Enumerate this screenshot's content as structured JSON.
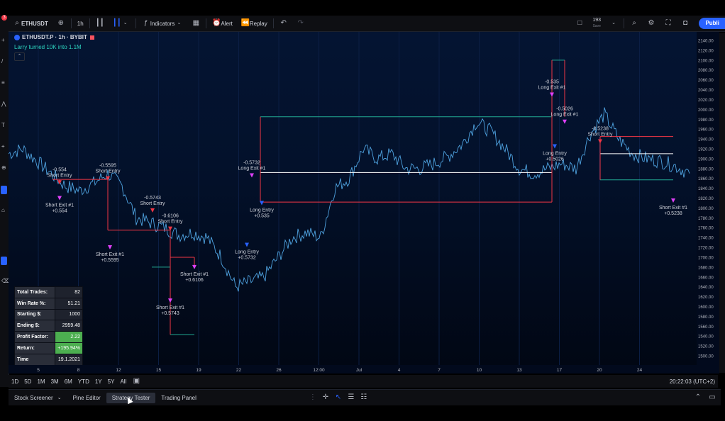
{
  "toolbar": {
    "symbol": "ETHUSDT",
    "interval": "1h",
    "indicators_label": "Indicators",
    "alert_label": "Alert",
    "replay_label": "Replay",
    "counter": "193",
    "counter_sub": "Save",
    "publish_label": "Publi",
    "notification_badge": "3"
  },
  "legend": {
    "title": "ETHUSDT.P · 1h · BYBIT",
    "strategy_name": "Larry turned 10K into 1.1M"
  },
  "stats": [
    {
      "label": "Total Trades:",
      "value": "82",
      "highlight": false
    },
    {
      "label": "Win Rate %:",
      "value": "51.21",
      "highlight": false
    },
    {
      "label": "Starting $:",
      "value": "1000",
      "highlight": false
    },
    {
      "label": "Ending $:",
      "value": "2959.48",
      "highlight": false
    },
    {
      "label": "Profit Factor:",
      "value": "2.22",
      "highlight": true
    },
    {
      "label": "Return:",
      "value": "+195.94%",
      "highlight": true
    },
    {
      "label": "Time",
      "value": "19.1.2021",
      "highlight": false
    }
  ],
  "chart_data": {
    "type": "line",
    "price_ticks": [
      "2140.00",
      "2120.00",
      "2100.00",
      "2080.00",
      "2060.00",
      "2040.00",
      "2020.00",
      "2000.00",
      "1980.00",
      "1960.00",
      "1940.00",
      "1920.00",
      "1900.00",
      "1880.00",
      "1860.00",
      "1840.00",
      "1820.00",
      "1800.00",
      "1780.00",
      "1760.00",
      "1740.00",
      "1720.00",
      "1700.00",
      "1680.00",
      "1660.00",
      "1640.00",
      "1620.00",
      "1600.00",
      "1580.00",
      "1560.00",
      "1540.00",
      "1520.00",
      "1500.00"
    ],
    "time_ticks": [
      "5",
      "8",
      "12",
      "15",
      "19",
      "22",
      "26",
      "12:00",
      "Jul",
      "4",
      "7",
      "10",
      "13",
      "17",
      "20",
      "24"
    ],
    "ylim": [
      1492,
      2150
    ],
    "price_line": {
      "x": [
        0,
        20,
        40,
        60,
        80,
        100,
        120,
        140,
        160,
        180,
        200,
        220,
        240,
        260,
        280,
        300,
        320,
        340,
        360,
        380,
        400,
        420,
        440,
        460,
        480,
        500,
        520,
        540,
        560,
        580,
        600,
        620,
        640,
        660,
        680,
        700,
        720,
        740,
        760,
        780,
        800,
        820,
        840,
        860,
        880,
        900,
        920,
        940,
        960
      ],
      "y": [
        1910,
        1920,
        1895,
        1870,
        1845,
        1835,
        1850,
        1870,
        1845,
        1780,
        1770,
        1760,
        1745,
        1750,
        1740,
        1700,
        1640,
        1650,
        1660,
        1700,
        1740,
        1750,
        1740,
        1840,
        1860,
        1920,
        1900,
        1910,
        1880,
        1880,
        1890,
        1905,
        1930,
        1975,
        1955,
        1920,
        1880,
        1870,
        1880,
        1890,
        1880,
        1950,
        1990,
        1940,
        1910,
        1900,
        1895,
        1885,
        1870
      ]
    },
    "trades": [
      {
        "t": 72,
        "price": 1852,
        "kind": "short-entry",
        "text": "-0.554",
        "text2": "Short Entry"
      },
      {
        "t": 72,
        "price": 1820,
        "kind": "short-exit",
        "text": "Short Exit #1",
        "text2": "+0.554"
      },
      {
        "t": 140,
        "price": 1860,
        "kind": "short-entry",
        "text": "-0.5595",
        "text2": "Short Entry"
      },
      {
        "t": 143,
        "price": 1720,
        "kind": "short-exit",
        "text": "Short Exit #1",
        "text2": "+0.5595"
      },
      {
        "t": 203,
        "price": 1795,
        "kind": "short-entry",
        "text": "-0.5743",
        "text2": "Short Entry"
      },
      {
        "t": 228,
        "price": 1758,
        "kind": "short-entry",
        "text": "-0.6106",
        "text2": "Short Entry"
      },
      {
        "t": 262,
        "price": 1680,
        "kind": "short-exit",
        "text": "Short Exit #1",
        "text2": "+0.6106"
      },
      {
        "t": 228,
        "price": 1612,
        "kind": "short-exit",
        "text": "Short Exit #1",
        "text2": "+0.5743"
      },
      {
        "t": 336,
        "price": 1725,
        "kind": "long-entry",
        "text": "Long Entry",
        "text2": "+0.5732"
      },
      {
        "t": 343,
        "price": 1866,
        "kind": "long-exit",
        "text": "-0.5732",
        "text2": "Long Exit #1"
      },
      {
        "t": 357,
        "price": 1810,
        "kind": "long-entry",
        "text": "Long Entry",
        "text2": "+0.535"
      },
      {
        "t": 766,
        "price": 2030,
        "kind": "long-exit",
        "text": "-0.535",
        "text2": "Long Exit #1"
      },
      {
        "t": 770,
        "price": 1925,
        "kind": "long-entry",
        "text": "Long Entry",
        "text2": "+0.5026"
      },
      {
        "t": 784,
        "price": 1975,
        "kind": "long-exit",
        "text": "-0.5026",
        "text2": "Long Exit #1"
      },
      {
        "t": 834,
        "price": 1935,
        "kind": "short-entry",
        "text": "-0.5238",
        "text2": "Short Entry"
      },
      {
        "t": 937,
        "price": 1815,
        "kind": "short-exit",
        "text": "Short Exit #1",
        "text2": "+0.5238"
      }
    ],
    "levels": [
      {
        "x1": 62,
        "x2": 140,
        "price": 1858,
        "color": "#f23645"
      },
      {
        "x1": 140,
        "x2": 228,
        "price": 1755,
        "color": "#f23645"
      },
      {
        "x1": 228,
        "x2": 262,
        "price": 1700,
        "color": "#f23645"
      },
      {
        "x1": 202,
        "x2": 228,
        "price": 1680,
        "color": "#22ab94"
      },
      {
        "x1": 228,
        "x2": 262,
        "price": 1543,
        "color": "#22ab94"
      },
      {
        "x1": 355,
        "x2": 766,
        "price": 1985,
        "color": "#22ab94"
      },
      {
        "x1": 355,
        "x2": 766,
        "price": 1872,
        "color": "#ffffff"
      },
      {
        "x1": 355,
        "x2": 766,
        "price": 1812,
        "color": "#f23645"
      },
      {
        "x1": 766,
        "x2": 784,
        "price": 2100,
        "color": "#22ab94"
      },
      {
        "x1": 834,
        "x2": 937,
        "price": 1945,
        "color": "#f23645"
      },
      {
        "x1": 834,
        "x2": 937,
        "price": 1910,
        "color": "#ffffff"
      },
      {
        "x1": 834,
        "x2": 937,
        "price": 1857,
        "color": "#22ab94"
      }
    ]
  },
  "range_buttons": [
    "1D",
    "5D",
    "1M",
    "3M",
    "6M",
    "YTD",
    "1Y",
    "5Y",
    "All"
  ],
  "clock": "20:22:03 (UTC+2)",
  "bottom_tabs": [
    {
      "label": "Stock Screener",
      "active": false
    },
    {
      "label": "Pine Editor",
      "active": false
    },
    {
      "label": "Strategy Tester",
      "active": true
    },
    {
      "label": "Trading Panel",
      "active": false
    }
  ]
}
